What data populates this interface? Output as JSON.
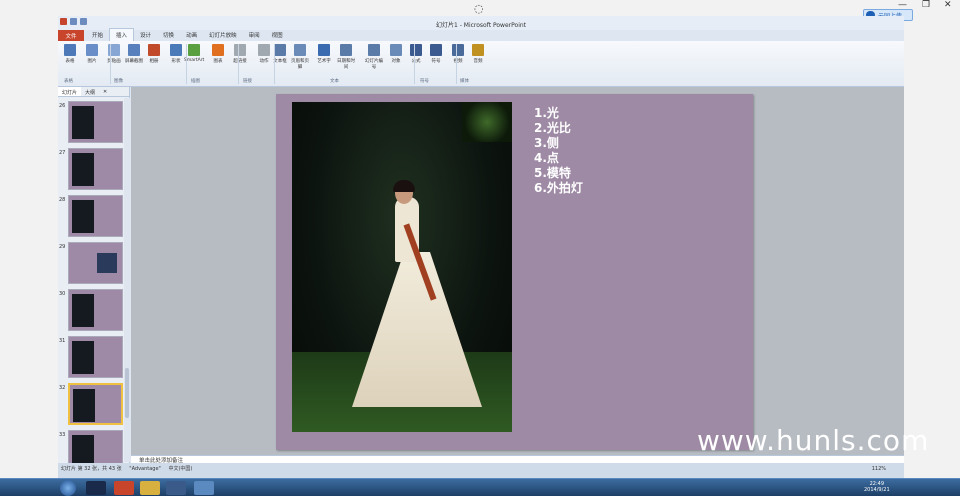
{
  "app": {
    "title": "幻灯片1 - Microsoft PowerPoint",
    "cloud_label": "云同上传"
  },
  "ribbon": {
    "tabs": [
      "开始",
      "插入",
      "设计",
      "切换",
      "动画",
      "幻灯片放映",
      "审阅",
      "视图"
    ],
    "file_tab": "文件",
    "active_tab": "插入",
    "buttons": [
      {
        "label": "表格",
        "color": "#4d79b8"
      },
      {
        "label": "图片",
        "color": "#6a8ec8"
      },
      {
        "label": "剪贴画",
        "color": "#88a6d4"
      },
      {
        "label": "屏幕截图",
        "color": "#5780bc"
      },
      {
        "label": "相册",
        "color": "#c04a2a"
      },
      {
        "label": "形状",
        "color": "#4a7ab8"
      },
      {
        "label": "SmartArt",
        "color": "#5aa040"
      },
      {
        "label": "图表",
        "color": "#e07020"
      },
      {
        "label": "超链接",
        "color": "#a0a8b0"
      },
      {
        "label": "动作",
        "color": "#a0a8b0"
      },
      {
        "label": "文本框",
        "color": "#5a7aa8"
      },
      {
        "label": "页眉和页脚",
        "color": "#6a8ab8"
      },
      {
        "label": "艺术字",
        "color": "#3a6ab0"
      },
      {
        "label": "日期和时间",
        "color": "#5a7aa8"
      },
      {
        "label": "幻灯片编号",
        "color": "#5a7aa8"
      },
      {
        "label": "对象",
        "color": "#6a8ab8"
      },
      {
        "label": "公式",
        "color": "#3a5a90"
      },
      {
        "label": "符号",
        "color": "#3a5a90"
      },
      {
        "label": "视频",
        "color": "#4a6a9a"
      },
      {
        "label": "音频",
        "color": "#c09020"
      }
    ],
    "groups": [
      "表格",
      "图像",
      "插图",
      "链接",
      "文本",
      "符号",
      "媒体"
    ]
  },
  "panel": {
    "tab_slides": "幻灯片",
    "tab_outline": "大纲",
    "thumbs": [
      "26",
      "27",
      "28",
      "29",
      "30",
      "31",
      "32",
      "33"
    ]
  },
  "slide": {
    "items": [
      "1.光",
      "2.光比",
      "3.侧",
      "4.点",
      "5.模特",
      "6.外拍灯"
    ]
  },
  "notes": {
    "placeholder": "单击此处添加备注"
  },
  "status": {
    "slide_info": "幻灯片 第 32 张，共 43 张",
    "theme": "\"Advantage\"",
    "lang": "中文(中国)",
    "zoom": "112%"
  },
  "taskbar": {
    "time": "22:49",
    "date": "2014/9/21"
  },
  "watermark": "www.hunls.com"
}
